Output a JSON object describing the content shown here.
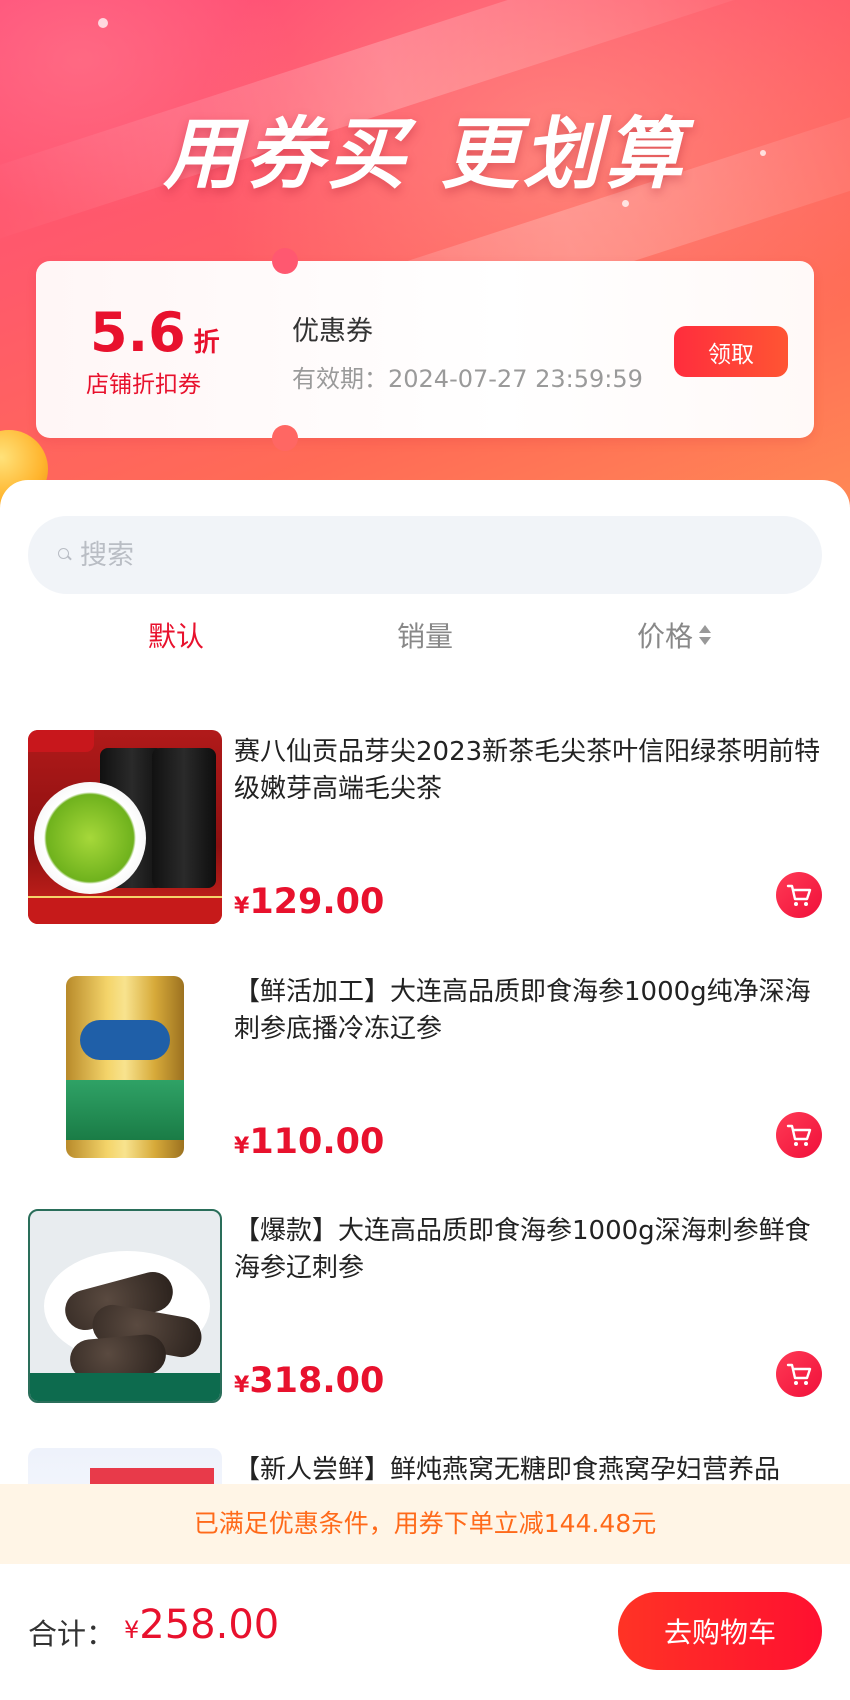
{
  "hero": {
    "title": "用券买 更划算"
  },
  "coupon": {
    "discount_value": "5.6",
    "discount_unit": "折",
    "coupon_type": "店铺折扣券",
    "name": "优惠券",
    "validity": "有效期：2024-07-27 23:59:59",
    "claim_label": "领取"
  },
  "search": {
    "placeholder": "搜索",
    "icon": "search-icon"
  },
  "sort_tabs": [
    {
      "label": "默认",
      "active": true
    },
    {
      "label": "销量",
      "active": false
    },
    {
      "label": "价格",
      "active": false,
      "icon": "sort-arrows-icon"
    }
  ],
  "products": [
    {
      "title": "赛八仙贡品芽尖2023新茶毛尖茶叶信阳绿茶明前特级嫩芽高端毛尖茶",
      "currency": "¥",
      "price": "129.00"
    },
    {
      "title": "【鲜活加工】大连高品质即食海参1000g纯净深海刺参底播冷冻辽参",
      "currency": "¥",
      "price": "110.00"
    },
    {
      "title": "【爆款】大连高品质即食海参1000g深海刺参鲜食海参辽刺参",
      "currency": "¥",
      "price": "318.00"
    },
    {
      "title": "【新人尝鲜】鲜炖燕窝无糖即食燕窝孕妇营养品",
      "currency": "¥",
      "price": ""
    }
  ],
  "notice": {
    "text": "已满足优惠条件，用券下单立减144.48元"
  },
  "footer": {
    "total_label": "合计：",
    "currency": "¥",
    "total_amount": "258.00",
    "checkout_label": "去购物车"
  },
  "colors": {
    "accent": "#e8112d",
    "notice_text": "#ff6a1a",
    "notice_bg": "#fff5e6",
    "hero_gradient_start": "#ff4e7a",
    "hero_gradient_end": "#ff8a55"
  }
}
